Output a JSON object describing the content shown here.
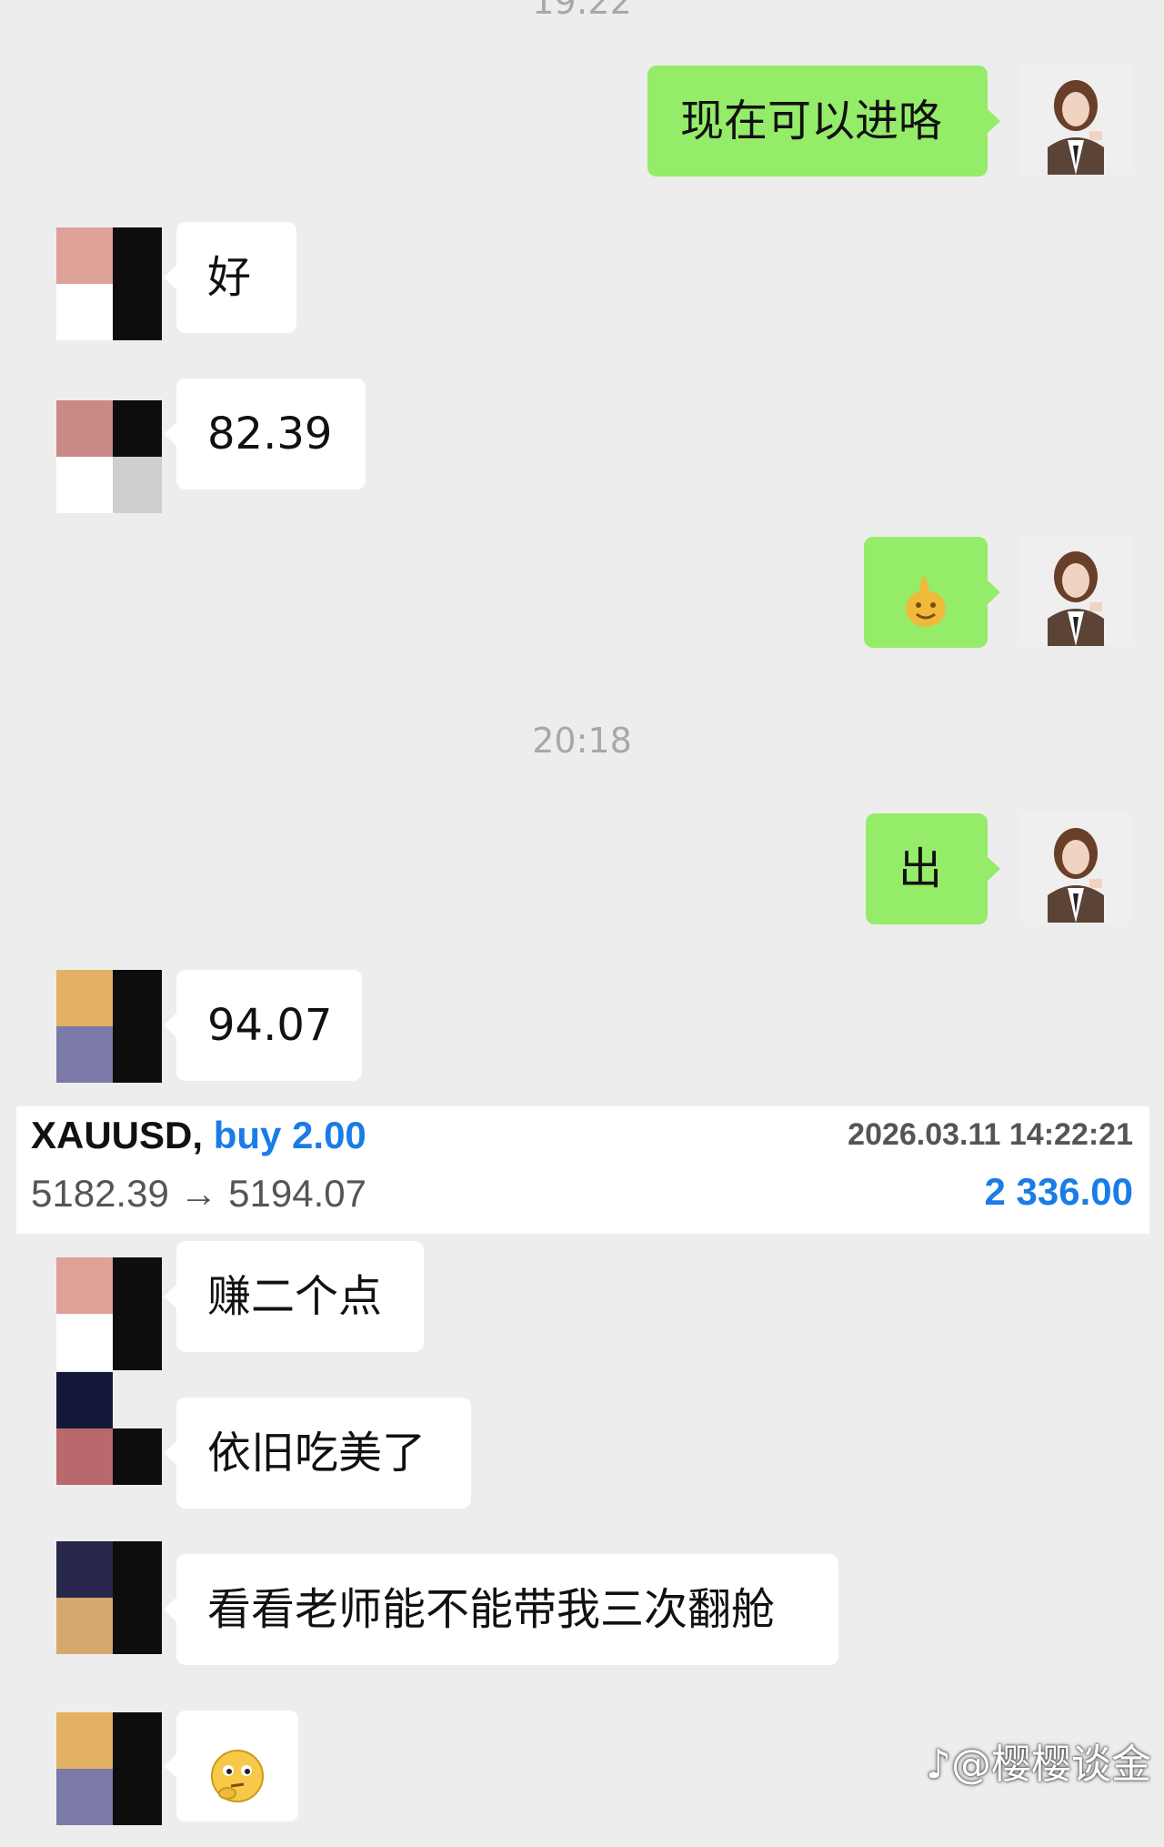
{
  "timestamps": {
    "top": "19:22",
    "middle": "20:18"
  },
  "messages": {
    "m1": "现在可以进咯",
    "m2": "好",
    "m3": "82.39",
    "m5": "出",
    "m6": "94.07",
    "m7": "赚二个点",
    "m8": "依旧吃美了",
    "m9": "看看老师能不能带我三次翻舱"
  },
  "trade": {
    "symbol": "XAUUSD,",
    "side": "buy 2.00",
    "datetime": "2026.03.11 14:22:21",
    "prices": "5182.39 → 5194.07",
    "profit": "2 336.00"
  },
  "watermark": "@樱樱谈金",
  "colors": {
    "self_bubble": "#95ec69",
    "other_bubble": "#ffffff",
    "background": "#ededed",
    "profit_blue": "#1a7ce6"
  }
}
